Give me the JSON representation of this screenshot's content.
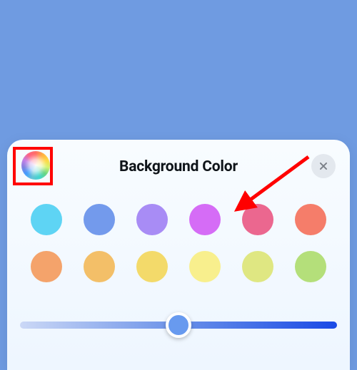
{
  "panel": {
    "title": "Background Color",
    "close_label": "Close",
    "color_wheel_label": "Custom Color",
    "colors_row1": [
      "#5ed4f4",
      "#739aec",
      "#a88cf5",
      "#d56cf6",
      "#eb678f",
      "#f57d6a"
    ],
    "colors_row2": [
      "#f4a36b",
      "#f3bf68",
      "#f3da6a",
      "#f8ef8d",
      "#dfe782",
      "#b4df7a"
    ],
    "slider": {
      "min": 0,
      "max": 100,
      "value": 50
    },
    "accent": "#689aef"
  }
}
